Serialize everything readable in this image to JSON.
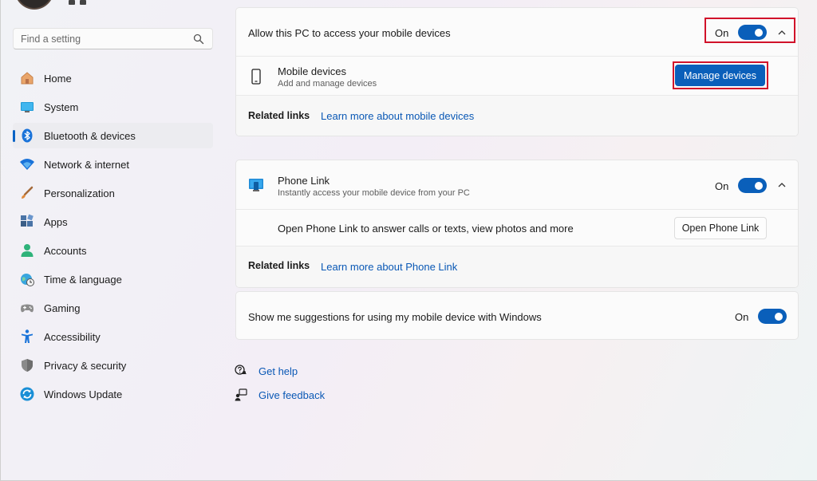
{
  "search": {
    "placeholder": "Find a setting",
    "icon": "search-icon"
  },
  "sidebar": {
    "items": [
      {
        "label": "Home",
        "icon": "home-icon"
      },
      {
        "label": "System",
        "icon": "system-icon"
      },
      {
        "label": "Bluetooth & devices",
        "icon": "bluetooth-icon",
        "active": true
      },
      {
        "label": "Network & internet",
        "icon": "wifi-icon"
      },
      {
        "label": "Personalization",
        "icon": "brush-icon"
      },
      {
        "label": "Apps",
        "icon": "apps-icon"
      },
      {
        "label": "Accounts",
        "icon": "accounts-icon"
      },
      {
        "label": "Time & language",
        "icon": "globe-clock-icon"
      },
      {
        "label": "Gaming",
        "icon": "gamepad-icon"
      },
      {
        "label": "Accessibility",
        "icon": "accessibility-icon"
      },
      {
        "label": "Privacy & security",
        "icon": "shield-icon"
      },
      {
        "label": "Windows Update",
        "icon": "update-icon"
      }
    ]
  },
  "mobile_access": {
    "title": "Allow this PC to access your mobile devices",
    "toggle_label": "On",
    "toggle_on": true,
    "devices_title": "Mobile devices",
    "devices_subtitle": "Add and manage devices",
    "manage_button": "Manage devices",
    "related_label": "Related links",
    "related_link": "Learn more about mobile devices"
  },
  "phone_link": {
    "title": "Phone Link",
    "subtitle": "Instantly access your mobile device from your PC",
    "toggle_label": "On",
    "toggle_on": true,
    "open_text": "Open Phone Link to answer calls or texts, view photos and more",
    "open_button": "Open Phone Link",
    "related_label": "Related links",
    "related_link": "Learn more about Phone Link"
  },
  "suggestions": {
    "title": "Show me suggestions for using my mobile device with Windows",
    "toggle_label": "On",
    "toggle_on": true
  },
  "help": {
    "get_help": "Get help",
    "give_feedback": "Give feedback"
  },
  "colors": {
    "accent": "#0a5fba",
    "link": "#0a58b5",
    "highlight": "#d1122a"
  }
}
